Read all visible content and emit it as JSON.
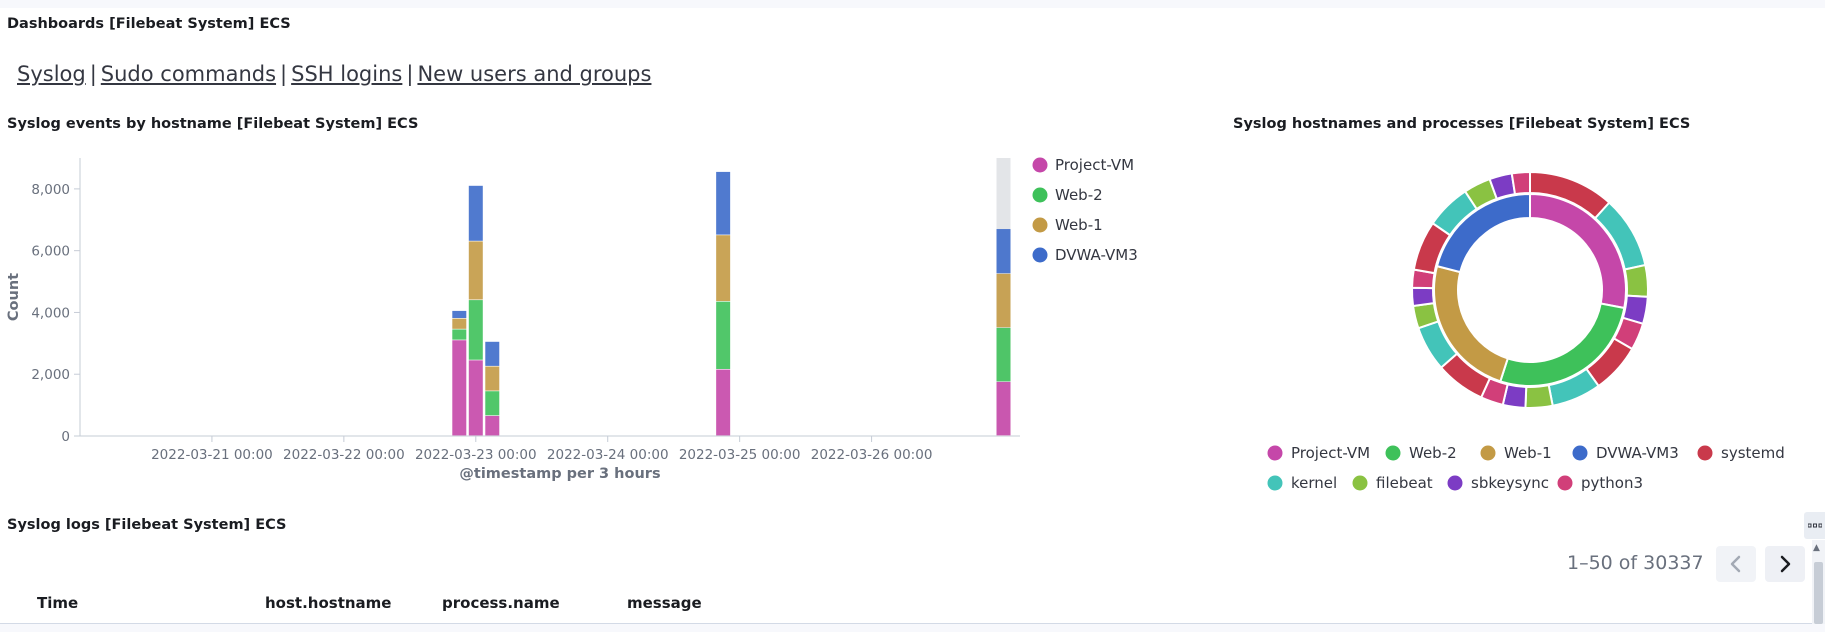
{
  "dashboard": {
    "title": "Dashboards [Filebeat System] ECS"
  },
  "nav_links": [
    {
      "label": "Syslog"
    },
    {
      "label": "Sudo commands"
    },
    {
      "label": "SSH logins"
    },
    {
      "label": "New users and groups"
    }
  ],
  "nav_separator": "|",
  "bar_panel": {
    "title": "Syslog events by hostname [Filebeat System] ECS"
  },
  "donut_panel": {
    "title": "Syslog hostnames and processes [Filebeat System] ECS"
  },
  "logs_panel": {
    "title": "Syslog logs [Filebeat System] ECS",
    "pagination": {
      "text": "1–50 of 30337",
      "prev_icon": "chevron-left-icon",
      "next_icon": "chevron-right-icon"
    },
    "columns": [
      "Time",
      "host.hostname",
      "process.name",
      "message"
    ]
  },
  "colors": {
    "Project-VM": "#c547a9",
    "Web-2": "#3ec15a",
    "Web-1": "#c39a45",
    "DVWA-VM3": "#3d6bca",
    "systemd": "#c9394b",
    "kernel": "#43c4b9",
    "filebeat": "#8ac242",
    "sbkeysync": "#7c3cc4",
    "python3": "#d13f79"
  },
  "chart_data": [
    {
      "type": "bar",
      "stacked": true,
      "title": "",
      "xlabel": "@timestamp per 3 hours",
      "ylabel": "Count",
      "x_tick_labels": [
        "2022-03-21 00:00",
        "2022-03-22 00:00",
        "2022-03-23 00:00",
        "2022-03-24 00:00",
        "2022-03-25 00:00",
        "2022-03-26 00:00"
      ],
      "y_tick_labels": [
        "0",
        "2,000",
        "4,000",
        "6,000",
        "8,000"
      ],
      "ylim": [
        0,
        9000
      ],
      "legend_position": "right",
      "x": [
        "2022-03-22 21:00",
        "2022-03-23 00:00",
        "2022-03-23 03:00",
        "2022-03-24 21:00",
        "2022-03-27 00:00"
      ],
      "series": [
        {
          "name": "Project-VM",
          "values": [
            3100,
            2450,
            650,
            2150,
            1750
          ]
        },
        {
          "name": "Web-2",
          "values": [
            350,
            1950,
            800,
            2200,
            1750
          ]
        },
        {
          "name": "Web-1",
          "values": [
            350,
            1900,
            800,
            2150,
            1750
          ]
        },
        {
          "name": "DVWA-VM3",
          "values": [
            250,
            1800,
            800,
            2050,
            1450
          ]
        }
      ]
    },
    {
      "type": "pie",
      "donut": true,
      "legend_position": "bottom",
      "legend": [
        "Project-VM",
        "Web-2",
        "Web-1",
        "DVWA-VM3",
        "systemd",
        "kernel",
        "filebeat",
        "sbkeysync",
        "python3"
      ],
      "inner_ring": [
        {
          "label": "Project-VM",
          "value": 28
        },
        {
          "label": "Web-2",
          "value": 27
        },
        {
          "label": "Web-1",
          "value": 24
        },
        {
          "label": "DVWA-VM3",
          "value": 21
        }
      ],
      "outer_ring": [
        {
          "label": "systemd",
          "value": 9.5
        },
        {
          "label": "kernel",
          "value": 8
        },
        {
          "label": "filebeat",
          "value": 3.5
        },
        {
          "label": "sbkeysync",
          "value": 3
        },
        {
          "label": "python3",
          "value": 3
        },
        {
          "label": "systemd",
          "value": 5.5
        },
        {
          "label": "kernel",
          "value": 5.5
        },
        {
          "label": "filebeat",
          "value": 3
        },
        {
          "label": "sbkeysync",
          "value": 2.5
        },
        {
          "label": "python3",
          "value": 2.5
        },
        {
          "label": "systemd",
          "value": 5.5
        },
        {
          "label": "kernel",
          "value": 5
        },
        {
          "label": "filebeat",
          "value": 2.5
        },
        {
          "label": "sbkeysync",
          "value": 2
        },
        {
          "label": "python3",
          "value": 2
        },
        {
          "label": "systemd",
          "value": 5.5
        },
        {
          "label": "kernel",
          "value": 5
        },
        {
          "label": "filebeat",
          "value": 3
        },
        {
          "label": "sbkeysync",
          "value": 2.5
        },
        {
          "label": "python3",
          "value": 2
        }
      ]
    }
  ]
}
